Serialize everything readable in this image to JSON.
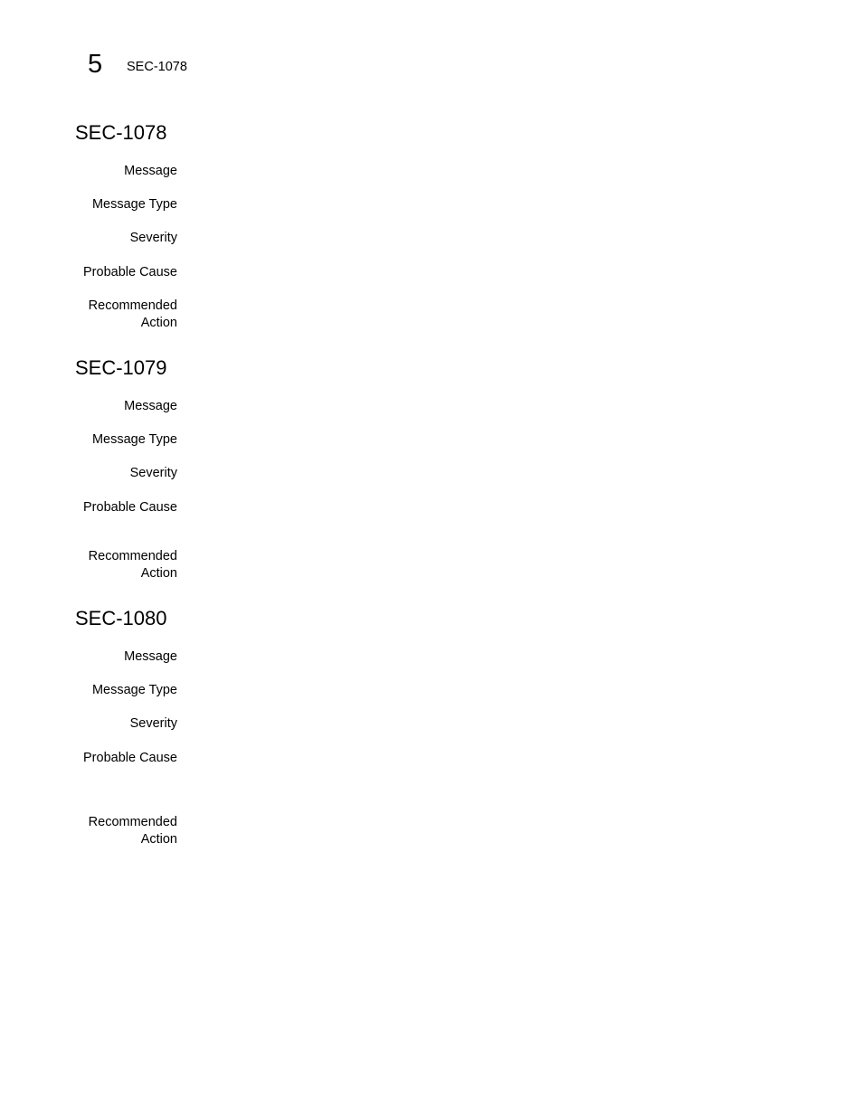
{
  "header": {
    "chapter_number": "5",
    "running_title": "SEC-1078"
  },
  "sections": [
    {
      "title": "SEC-1078",
      "fields": [
        {
          "label": "Message",
          "value": ""
        },
        {
          "label": "Message Type",
          "value": ""
        },
        {
          "label": "Severity",
          "value": ""
        },
        {
          "label": "Probable Cause",
          "value": ""
        },
        {
          "label": "Recommended Action",
          "value": ""
        }
      ]
    },
    {
      "title": "SEC-1079",
      "fields": [
        {
          "label": "Message",
          "value": ""
        },
        {
          "label": "Message Type",
          "value": ""
        },
        {
          "label": "Severity",
          "value": ""
        },
        {
          "label": "Probable Cause",
          "value": ""
        },
        {
          "label": "Recommended Action",
          "value": ""
        }
      ]
    },
    {
      "title": "SEC-1080",
      "fields": [
        {
          "label": "Message",
          "value": ""
        },
        {
          "label": "Message Type",
          "value": ""
        },
        {
          "label": "Severity",
          "value": ""
        },
        {
          "label": "Probable Cause",
          "value": ""
        },
        {
          "label": "Recommended Action",
          "value": ""
        }
      ]
    }
  ]
}
